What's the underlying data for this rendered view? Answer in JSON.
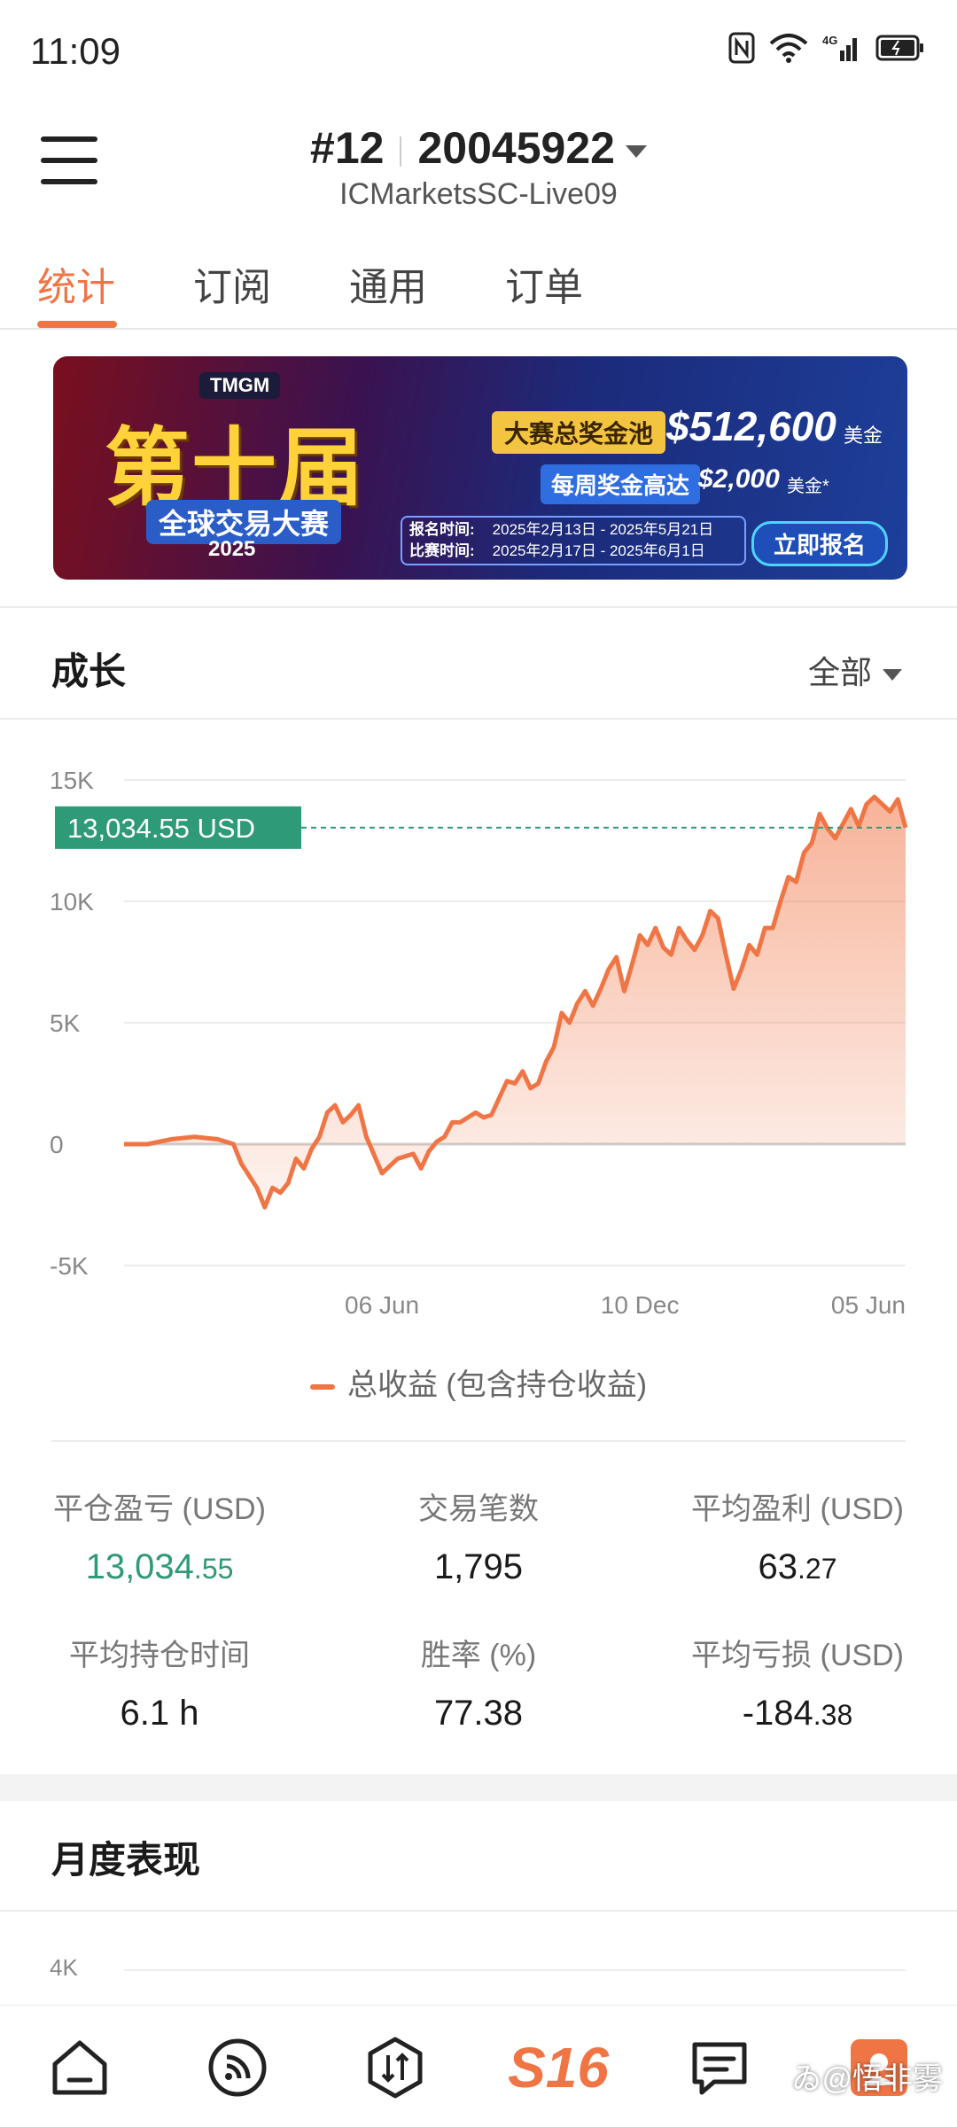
{
  "status_bar": {
    "time": "11:09"
  },
  "header": {
    "rank": "#12",
    "account_number": "20045922",
    "server": "ICMarketsSC-Live09"
  },
  "tabs": [
    {
      "label": "统计",
      "active": true
    },
    {
      "label": "订阅",
      "active": false
    },
    {
      "label": "通用",
      "active": false
    },
    {
      "label": "订单",
      "active": false
    }
  ],
  "banner": {
    "brand": "TMGM",
    "title": "第十届",
    "subtitle": "全球交易大赛",
    "year": "2025",
    "pool_label": "大赛总奖金池",
    "pool_amount": "$512,600",
    "pool_unit": "美金",
    "weekly_label": "每周奖金高达",
    "weekly_amount": "$2,000",
    "weekly_unit": "美金*",
    "signup_time_label": "报名时间:",
    "signup_time_value": "2025年2月13日 - 2025年5月21日",
    "contest_time_label": "比赛时间:",
    "contest_time_value": "2025年2月17日 - 2025年6月1日",
    "signup_button": "立即报名"
  },
  "growth": {
    "title": "成长",
    "range": "全部",
    "legend": "总收益 (包含持仓收益)",
    "current_label": "13,034.55 USD"
  },
  "chart_data": {
    "type": "area",
    "title": "",
    "xlabel": "",
    "ylabel": "",
    "ylim": [
      -5000,
      15000
    ],
    "yticks": [
      "15K",
      "10K",
      "5K",
      "0",
      "-5K"
    ],
    "xticks": [
      "06 Jun",
      "10 Dec",
      "05 Jun"
    ],
    "current_value": 13034.55,
    "colors": {
      "line": "#f07545",
      "fill": "#fbc9b3",
      "marker": "#2e9a78"
    },
    "series": [
      {
        "name": "总收益 (包含持仓收益)",
        "x": [
          0,
          0.03,
          0.06,
          0.09,
          0.12,
          0.14,
          0.15,
          0.17,
          0.18,
          0.19,
          0.2,
          0.21,
          0.22,
          0.23,
          0.24,
          0.25,
          0.26,
          0.27,
          0.28,
          0.29,
          0.3,
          0.31,
          0.33,
          0.35,
          0.37,
          0.38,
          0.39,
          0.4,
          0.41,
          0.42,
          0.43,
          0.44,
          0.45,
          0.46,
          0.47,
          0.49,
          0.5,
          0.51,
          0.52,
          0.53,
          0.54,
          0.55,
          0.56,
          0.57,
          0.58,
          0.59,
          0.6,
          0.61,
          0.62,
          0.63,
          0.64,
          0.65,
          0.66,
          0.67,
          0.68,
          0.69,
          0.7,
          0.71,
          0.72,
          0.73,
          0.74,
          0.75,
          0.76,
          0.77,
          0.78,
          0.79,
          0.8,
          0.81,
          0.82,
          0.83,
          0.84,
          0.85,
          0.86,
          0.87,
          0.88,
          0.89,
          0.9,
          0.91,
          0.92,
          0.93,
          0.94,
          0.95,
          0.96,
          0.97,
          0.98,
          0.99,
          1.0
        ],
        "values": [
          0,
          0,
          200,
          300,
          200,
          0,
          -800,
          -1800,
          -2600,
          -1800,
          -2000,
          -1600,
          -600,
          -1000,
          -200,
          300,
          1300,
          1600,
          900,
          1200,
          1600,
          300,
          -1200,
          -600,
          -400,
          -1000,
          -300,
          100,
          300,
          900,
          900,
          1100,
          1300,
          1100,
          1200,
          2600,
          2500,
          3000,
          2300,
          2500,
          3400,
          4000,
          5400,
          5000,
          5800,
          6300,
          5700,
          6400,
          7200,
          7700,
          6300,
          7400,
          8600,
          8200,
          8900,
          8100,
          7800,
          8900,
          8400,
          8000,
          8600,
          9600,
          9300,
          7800,
          6400,
          7200,
          8200,
          7800,
          8900,
          8900,
          10000,
          11000,
          10800,
          12000,
          12400,
          13600,
          13000,
          12600,
          13200,
          13800,
          13100,
          14000,
          14300,
          14000,
          13700,
          14200,
          13034.55
        ]
      }
    ]
  },
  "stats": [
    {
      "label": "平仓盈亏 (USD)",
      "main": "13,034",
      "decimals": ".55",
      "green": true
    },
    {
      "label": "交易笔数",
      "main": "1,795",
      "decimals": "",
      "green": false
    },
    {
      "label": "平均盈利 (USD)",
      "main": "63",
      "decimals": ".27",
      "green": false
    },
    {
      "label": "平均持仓时间",
      "main": "6.1 h",
      "decimals": "",
      "green": false
    },
    {
      "label": "胜率 (%)",
      "main": "77.38",
      "decimals": "",
      "green": false
    },
    {
      "label": "平均亏损 (USD)",
      "main": "-184",
      "decimals": ".38",
      "green": false
    }
  ],
  "monthly": {
    "title": "月度表现",
    "top_tick": "4K"
  },
  "bottom_nav": {
    "items": [
      {
        "icon": "home-icon"
      },
      {
        "icon": "signal-icon"
      },
      {
        "icon": "trade-icon"
      },
      {
        "label": "S16"
      },
      {
        "icon": "message-icon"
      },
      {
        "icon": "profile-icon"
      }
    ]
  },
  "watermark": "ゐ@悟非雾"
}
